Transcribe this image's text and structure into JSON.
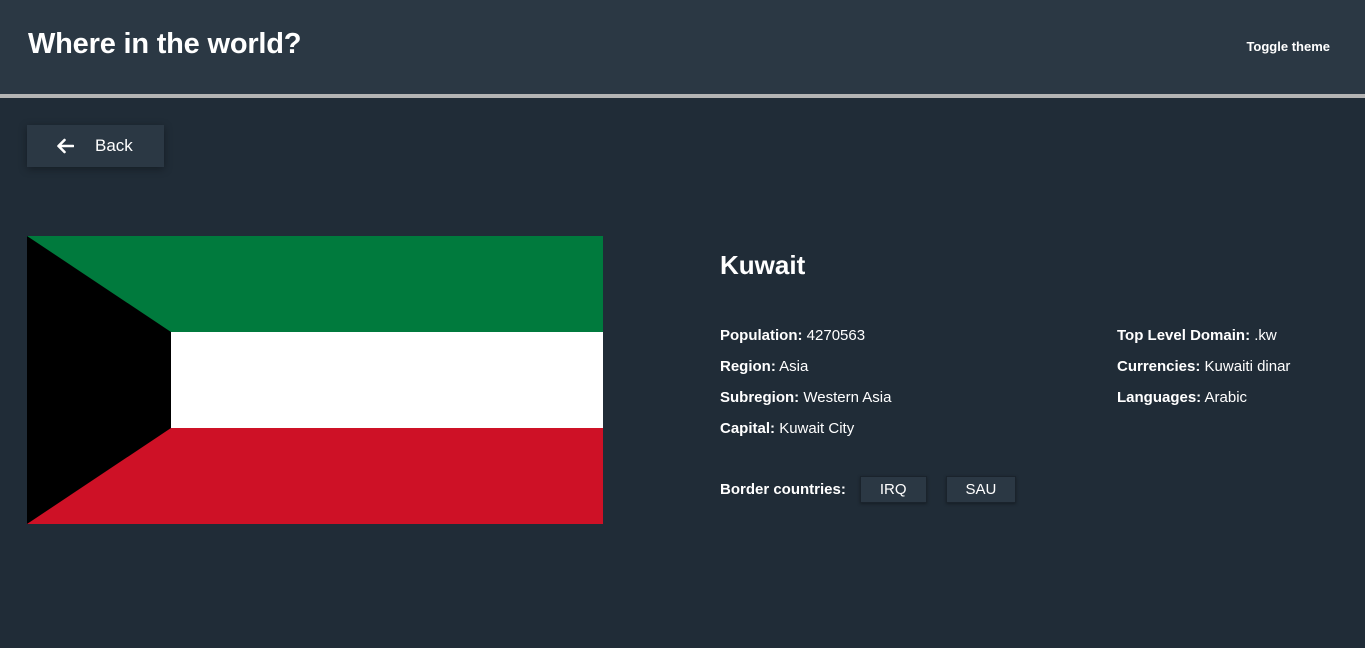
{
  "header": {
    "title": "Where in the world?",
    "toggle_label": "Toggle theme"
  },
  "back": {
    "label": "Back",
    "icon": "arrow-left-icon"
  },
  "country": {
    "name": "Kuwait",
    "flag_colors": {
      "green": "#007a3d",
      "white": "#ffffff",
      "red": "#ce1126",
      "black": "#000000"
    },
    "left_details": [
      {
        "label": "Population:",
        "value": "4270563"
      },
      {
        "label": "Region:",
        "value": "Asia"
      },
      {
        "label": "Subregion:",
        "value": "Western Asia"
      },
      {
        "label": "Capital:",
        "value": "Kuwait City"
      }
    ],
    "right_details": [
      {
        "label": "Top Level Domain:",
        "value": ".kw"
      },
      {
        "label": "Currencies:",
        "value": "Kuwaiti dinar"
      },
      {
        "label": "Languages:",
        "value": "Arabic"
      }
    ],
    "border_label": "Border countries:",
    "borders": [
      "IRQ",
      "SAU"
    ]
  },
  "theme": {
    "background": "#202c37",
    "surface": "#2b3844",
    "text": "#ffffff"
  }
}
